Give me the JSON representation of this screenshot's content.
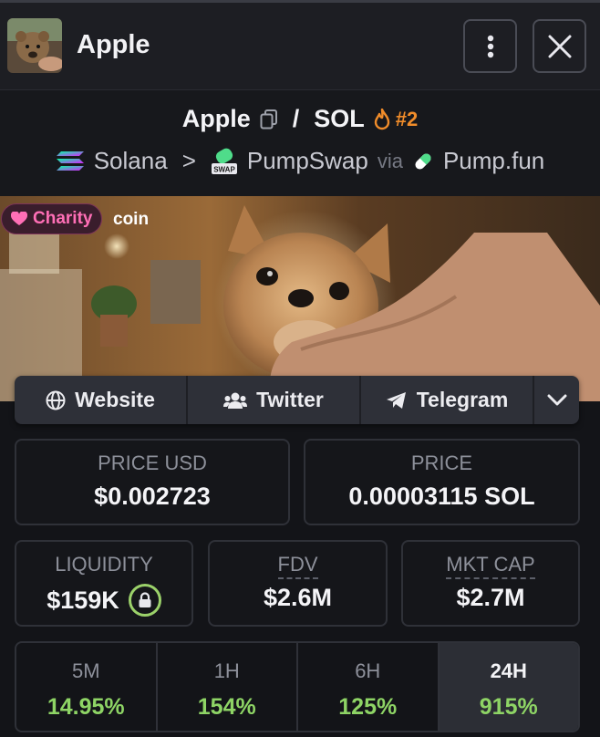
{
  "header": {
    "title": "Apple",
    "more_icon": "vertical-dots-icon",
    "close_icon": "close-icon"
  },
  "pair": {
    "base": "Apple",
    "separator": "/",
    "quote": "SOL",
    "rank": "#2",
    "chain": "Solana",
    "chevron": ">",
    "dex": "PumpSwap",
    "dex_badge": "SWAP",
    "via": "via",
    "launchpad": "Pump.fun"
  },
  "banner": {
    "charity_label": "Charity",
    "coin_label": "coin"
  },
  "links": {
    "website": "Website",
    "twitter": "Twitter",
    "telegram": "Telegram"
  },
  "stats": {
    "price_usd_label": "PRICE USD",
    "price_usd": "$0.002723",
    "price_label": "PRICE",
    "price": "0.00003115 SOL",
    "liquidity_label": "LIQUIDITY",
    "liquidity": "$159K",
    "fdv_label": "FDV",
    "fdv": "$2.6M",
    "mktcap_label": "MKT CAP",
    "mktcap": "$2.7M"
  },
  "periods": [
    {
      "label": "5M",
      "value": "14.95%"
    },
    {
      "label": "1H",
      "value": "154%"
    },
    {
      "label": "6H",
      "value": "125%"
    },
    {
      "label": "24H",
      "value": "915%"
    }
  ],
  "colors": {
    "accent_green": "#8ed465",
    "rank_orange": "#f08c2a",
    "charity_pink": "#ff6fb6"
  }
}
